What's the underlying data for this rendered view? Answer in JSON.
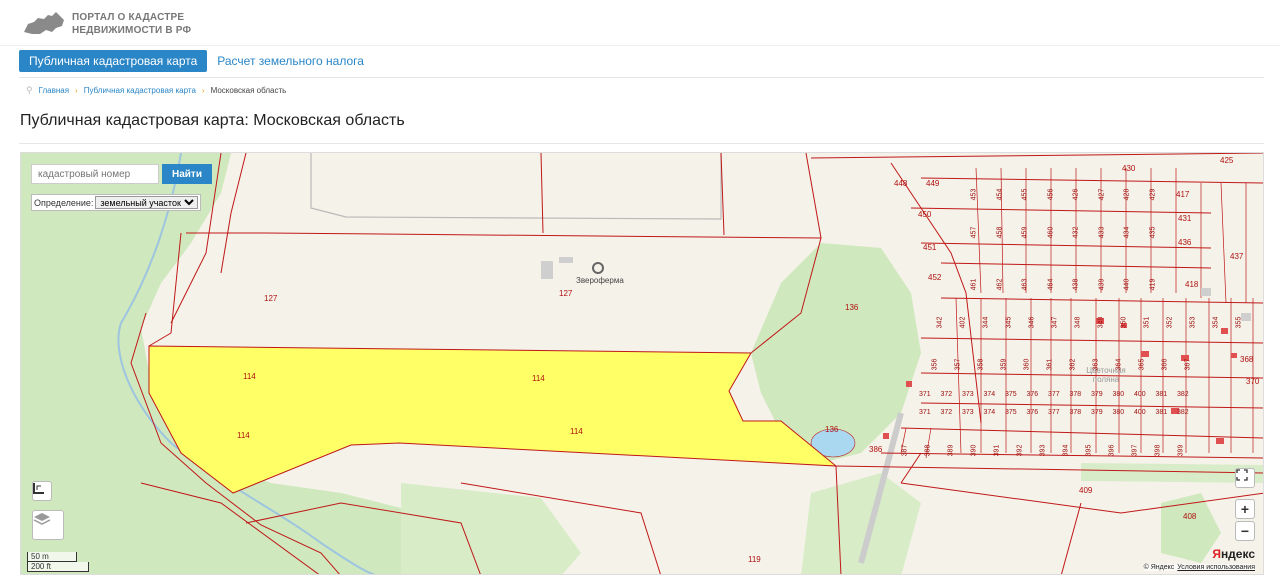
{
  "header": {
    "logo_line1": "ПОРТАЛ О КАДАСТРЕ",
    "logo_line2": "НЕДВИЖИМОСТИ В РФ"
  },
  "nav": {
    "tabs": [
      {
        "label": "Публичная кадастровая карта",
        "active": true
      },
      {
        "label": "Расчет земельного налога",
        "active": false
      }
    ]
  },
  "breadcrumb": {
    "items": [
      "Главная",
      "Публичная кадастровая карта",
      "Московская область"
    ]
  },
  "page_title": "Публичная кадастровая карта: Московская область",
  "map": {
    "search_placeholder": "кадастровый номер",
    "search_button": "Найти",
    "definition_label": "Определение:",
    "definition_value": "земельный участок",
    "poi_label": "Звероферма",
    "area_label": "Цветочная поляна",
    "parcel_labels": {
      "p127a": "127",
      "p127b": "127",
      "p136a": "136",
      "p136b": "136",
      "p114a": "114",
      "p114b": "114",
      "p114c": "114",
      "p114d": "114",
      "p119": "119",
      "p409": "409",
      "p408": "408",
      "p430": "430",
      "p425": "425",
      "p437": "437",
      "p448": "448",
      "p449": "449",
      "p450": "450",
      "p451": "451",
      "p452": "452",
      "p386": "386",
      "p417": "417",
      "p431": "431",
      "p436": "436",
      "p418": "418",
      "p368": "368",
      "p370": "370"
    },
    "grid_row1": [
      "453",
      "454",
      "455",
      "456",
      "426",
      "427",
      "428",
      "429"
    ],
    "grid_row2": [
      "457",
      "458",
      "459",
      "460",
      "432",
      "433",
      "434",
      "435"
    ],
    "grid_row3": [
      "461",
      "462",
      "463",
      "464",
      "438",
      "439",
      "440",
      "419"
    ],
    "grid_row4": [
      "342",
      "402",
      "344",
      "345",
      "346",
      "347",
      "348",
      "349",
      "350",
      "351",
      "352",
      "353",
      "354",
      "355"
    ],
    "grid_row5": [
      "356",
      "357",
      "358",
      "359",
      "360",
      "361",
      "362",
      "363",
      "364",
      "365",
      "366",
      "367"
    ],
    "grid_row6": [
      "371",
      "372",
      "373",
      "374",
      "375",
      "376",
      "377",
      "378",
      "379",
      "380",
      "400",
      "381",
      "382"
    ],
    "grid_row7": [
      "371",
      "372",
      "373",
      "374",
      "375",
      "376",
      "377",
      "378",
      "379",
      "380",
      "400",
      "381",
      "382"
    ],
    "grid_row8": [
      "387",
      "388",
      "389",
      "390",
      "391",
      "392",
      "393",
      "394",
      "395",
      "396",
      "397",
      "398",
      "399"
    ],
    "scale_m": "50 m",
    "scale_ft": "200 ft",
    "yandex_logo_ya": "Я",
    "yandex_logo_rest": "ндекс",
    "copyright": "© Яндекс",
    "terms_link": "Условия использования",
    "colors": {
      "parcel_line": "#c01818",
      "highlight": "#ffff66",
      "forest": "#c8e6b4",
      "water": "#a9d8f0",
      "land": "#f6f3ea"
    }
  }
}
